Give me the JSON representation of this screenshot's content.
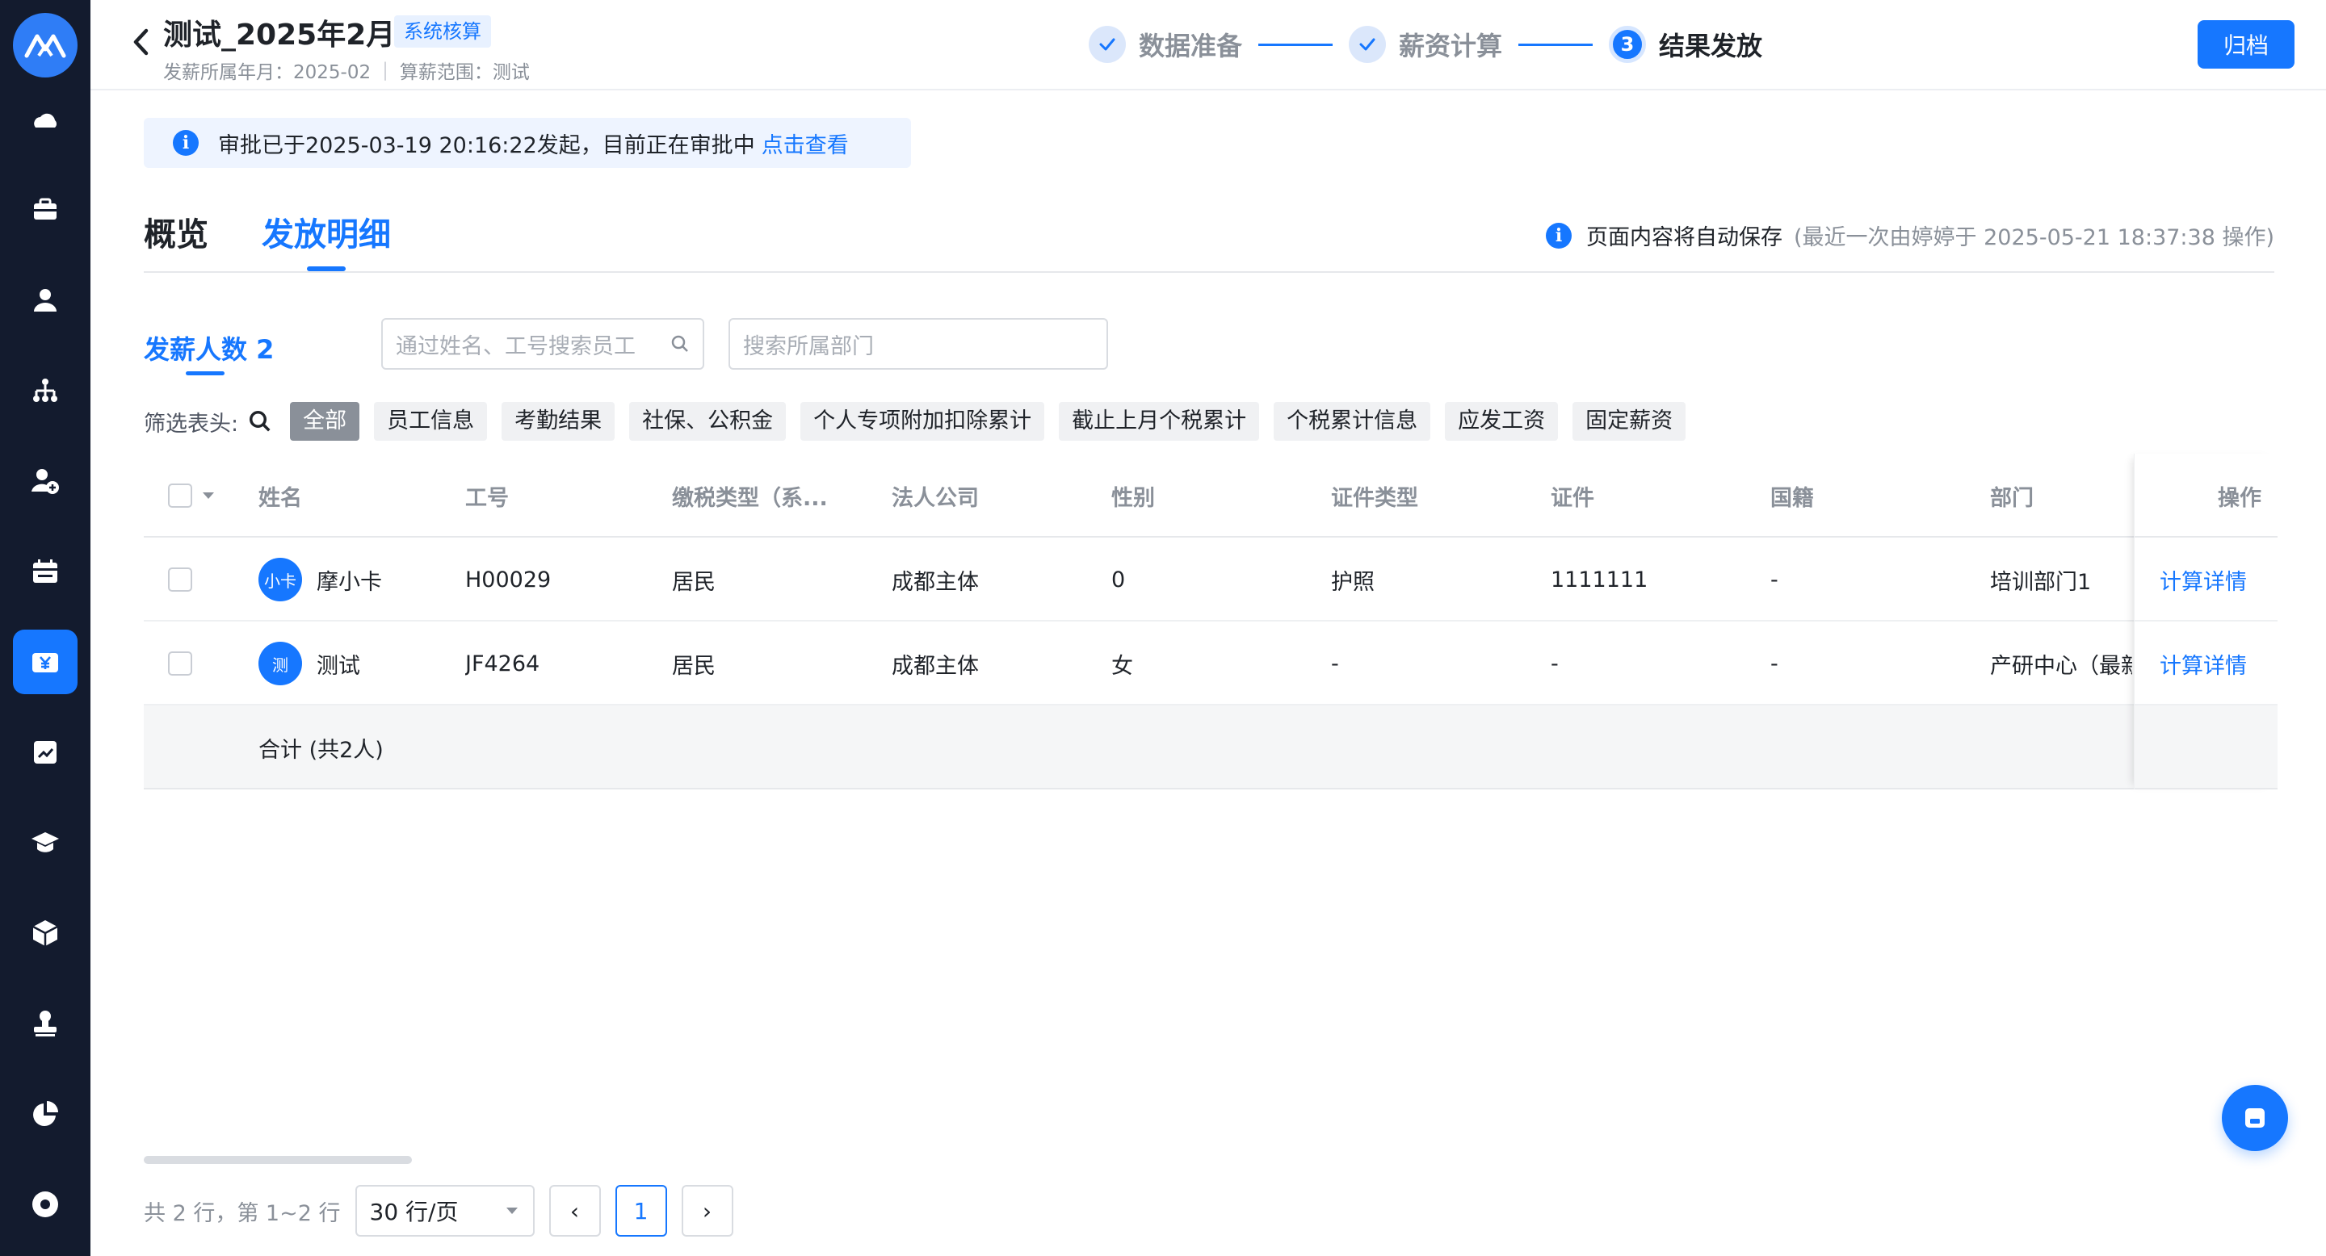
{
  "header": {
    "title": "测试_2025年2月",
    "badge": "系统核算",
    "pay_month": "发薪所属年月：2025-02",
    "scope": "算薪范围：测试",
    "archive_label": "归档"
  },
  "steps": [
    {
      "label": "数据准备",
      "state": "done"
    },
    {
      "label": "薪资计算",
      "state": "done"
    },
    {
      "number": "3",
      "label": "结果发放",
      "state": "current"
    }
  ],
  "notice": {
    "text": "审批已于2025-03-19 20:16:22发起，目前正在审批中",
    "link": "点击查看"
  },
  "tabs": [
    {
      "label": "概览",
      "active": false
    },
    {
      "label": "发放明细",
      "active": true
    }
  ],
  "autosave": {
    "text": "页面内容将自动保存",
    "detail": "(最近一次由婷婷于 2025-05-21 18:37:38 操作)"
  },
  "count_label": "发薪人数 2",
  "search": {
    "employee_placeholder": "通过姓名、工号搜索员工",
    "department_placeholder": "搜索所属部门"
  },
  "filter": {
    "label": "筛选表头:",
    "chips": [
      {
        "label": "全部",
        "active": true
      },
      {
        "label": "员工信息",
        "active": false
      },
      {
        "label": "考勤结果",
        "active": false
      },
      {
        "label": "社保、公积金",
        "active": false
      },
      {
        "label": "个人专项附加扣除累计",
        "active": false
      },
      {
        "label": "截止上月个税累计",
        "active": false
      },
      {
        "label": "个税累计信息",
        "active": false
      },
      {
        "label": "应发工资",
        "active": false
      },
      {
        "label": "固定薪资",
        "active": false
      }
    ]
  },
  "table": {
    "columns": [
      "姓名",
      "工号",
      "缴税类型（系...",
      "法人公司",
      "性别",
      "证件类型",
      "证件",
      "国籍",
      "部门",
      "操作"
    ],
    "rows": [
      {
        "avatar": "小卡",
        "name": "摩小卡",
        "id": "H00029",
        "tax_type": "居民",
        "company": "成都主体",
        "gender": "0",
        "id_type": "护照",
        "id_no": "1111111",
        "nationality": "-",
        "department": "培训部门1",
        "action": "计算详情"
      },
      {
        "avatar": "测",
        "name": "测试",
        "id": "JF4264",
        "tax_type": "居民",
        "company": "成都主体",
        "gender": "女",
        "id_type": "-",
        "id_no": "-",
        "nationality": "-",
        "department": "产研中心（最新",
        "action": "计算详情"
      }
    ],
    "footer": "合计 (共2人)"
  },
  "pagination": {
    "info": "共 2 行，第 1~2 行",
    "page_size": "30 行/页",
    "prev": "‹",
    "current": "1",
    "next": "›"
  },
  "colors": {
    "primary": "#1677ff",
    "sidebar": "#131b2e"
  },
  "icons": [
    "logo-icon",
    "cloud-icon",
    "briefcase-icon",
    "user-icon",
    "org-chart-icon",
    "user-add-icon",
    "calendar-icon",
    "salary-icon",
    "report-icon",
    "graduation-icon",
    "cube-icon",
    "stamp-icon",
    "pie-chart-icon",
    "disc-icon",
    "save-icon"
  ]
}
